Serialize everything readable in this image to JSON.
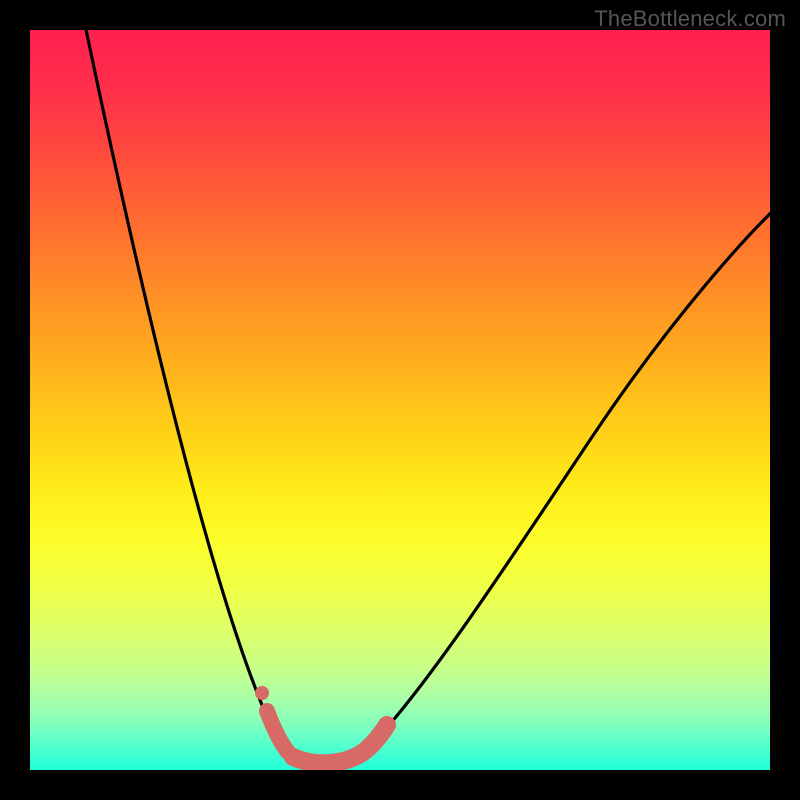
{
  "watermark": "TheBottleneck.com",
  "chart_data": {
    "type": "line",
    "title": "",
    "xlabel": "",
    "ylabel": "",
    "xlim": [
      0,
      100
    ],
    "ylim": [
      0,
      100
    ],
    "grid": false,
    "legend": false,
    "background": {
      "style": "vertical-gradient",
      "stops": [
        {
          "pos": 0.0,
          "color": "#ff1f50"
        },
        {
          "pos": 0.25,
          "color": "#ff7029"
        },
        {
          "pos": 0.5,
          "color": "#ffcc18"
        },
        {
          "pos": 0.7,
          "color": "#fbfe2c"
        },
        {
          "pos": 0.85,
          "color": "#c8ff87"
        },
        {
          "pos": 1.0,
          "color": "#22ffda"
        }
      ]
    },
    "series": [
      {
        "name": "bottleneck-curve",
        "color": "#000000",
        "x": [
          7,
          12,
          18,
          24,
          29,
          33,
          36,
          38,
          40,
          43,
          47,
          53,
          61,
          70,
          80,
          90,
          100
        ],
        "y": [
          100,
          80,
          58,
          38,
          20,
          8,
          2,
          0,
          0,
          2,
          8,
          20,
          36,
          52,
          66,
          75,
          80
        ]
      }
    ],
    "annotations": [
      {
        "name": "valley-highlight",
        "kind": "stroke",
        "color": "#d86a66",
        "x": [
          32,
          34,
          36,
          38,
          40,
          43,
          46,
          48
        ],
        "y": [
          10,
          5,
          2,
          0,
          0,
          1,
          4,
          7
        ]
      },
      {
        "name": "valley-dot",
        "kind": "point",
        "color": "#d86a66",
        "x": 31,
        "y": 12
      }
    ]
  }
}
